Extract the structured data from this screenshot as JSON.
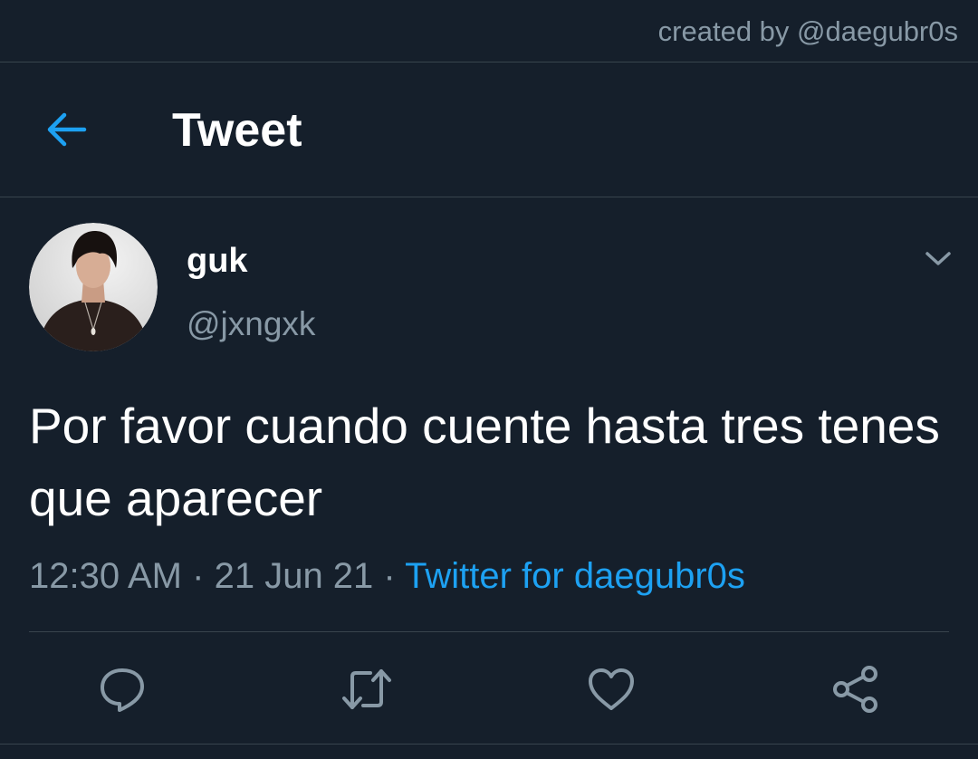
{
  "credit": "created by @daegubr0s",
  "header": {
    "back_icon": "arrow-left-icon",
    "title": "Tweet"
  },
  "tweet": {
    "author": {
      "display_name": "guk",
      "handle": "@jxngxk",
      "avatar_icon": "avatar-photo"
    },
    "menu_icon": "chevron-down-icon",
    "text": "Por favor cuando cuente hasta tres tenes que aparecer",
    "time": "12:30 AM",
    "date": "21 Jun 21",
    "separator": "·",
    "source": "Twitter for daegubr0s"
  },
  "actions": [
    {
      "name": "reply",
      "icon": "reply-bubble-icon"
    },
    {
      "name": "retweet",
      "icon": "retweet-icon"
    },
    {
      "name": "like",
      "icon": "heart-icon"
    },
    {
      "name": "share",
      "icon": "share-icon"
    }
  ],
  "colors": {
    "background": "#151f2b",
    "accent": "#1da1f2",
    "secondary_text": "#8899a6",
    "divider": "#38444d"
  }
}
